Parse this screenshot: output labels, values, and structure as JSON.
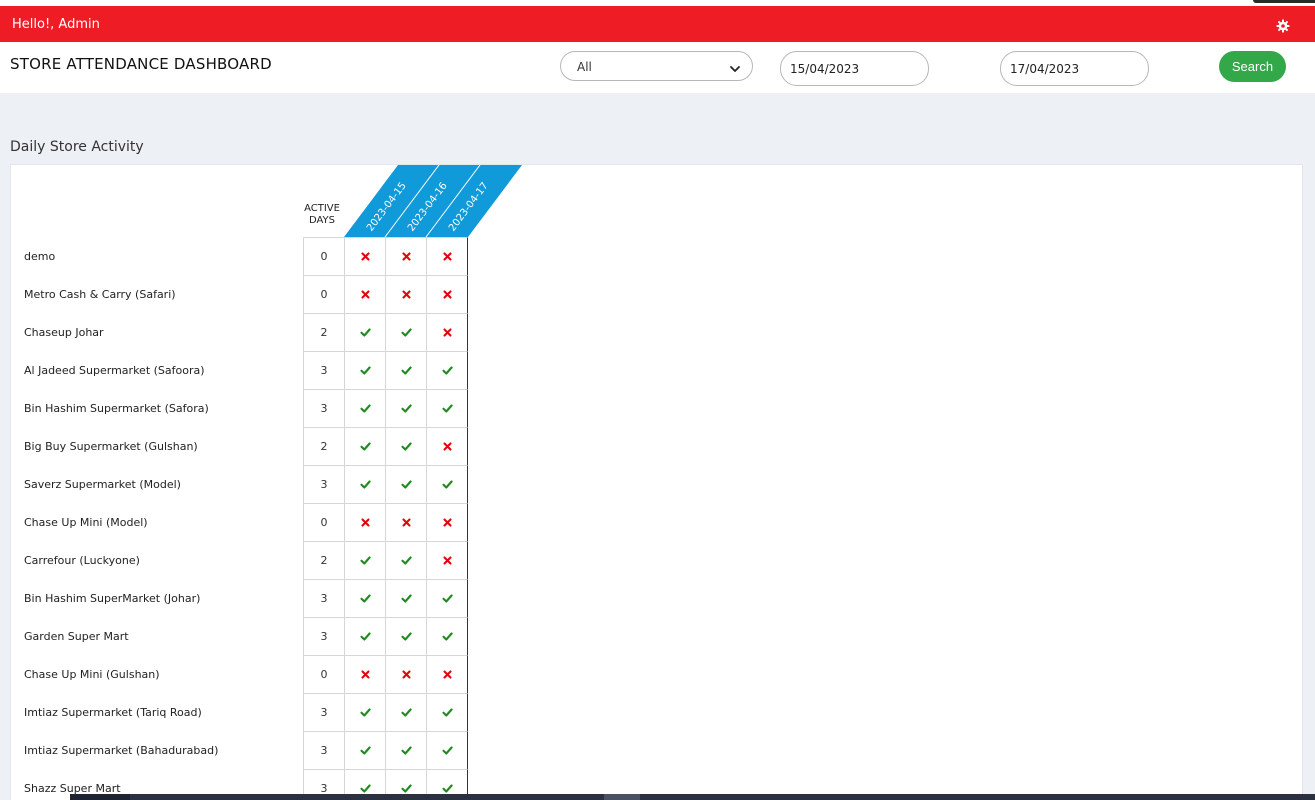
{
  "topbar": {
    "greeting": "Hello!, Admin",
    "settings_icon": "gear-icon",
    "color": "#ee1c25"
  },
  "header": {
    "title": "STORE ATTENDANCE DASHBOARD",
    "filter": {
      "selected": "All"
    },
    "date_from": "15/04/2023",
    "date_to": "17/04/2023",
    "search_label": "Search",
    "search_color": "#32a849"
  },
  "section": {
    "title": "Daily Store Activity"
  },
  "table": {
    "active_days_header": "ACTIVE DAYS",
    "dates": [
      "2023-04-15",
      "2023-04-16",
      "2023-04-17"
    ],
    "header_color": "#119ad9",
    "present_color": "#1f8a1f",
    "absent_color": "#e1060d",
    "rows": [
      {
        "name": "demo",
        "active_days": "0",
        "marks": [
          0,
          0,
          0
        ]
      },
      {
        "name": "Metro Cash & Carry (Safari)",
        "active_days": "0",
        "marks": [
          0,
          0,
          0
        ]
      },
      {
        "name": "Chaseup Johar",
        "active_days": "2",
        "marks": [
          1,
          1,
          0
        ]
      },
      {
        "name": "Al Jadeed Supermarket (Safoora)",
        "active_days": "3",
        "marks": [
          1,
          1,
          1
        ]
      },
      {
        "name": "Bin Hashim Supermarket (Safora)",
        "active_days": "3",
        "marks": [
          1,
          1,
          1
        ]
      },
      {
        "name": "Big Buy Supermarket (Gulshan)",
        "active_days": "2",
        "marks": [
          1,
          1,
          0
        ]
      },
      {
        "name": "Saverz Supermarket (Model)",
        "active_days": "3",
        "marks": [
          1,
          1,
          1
        ]
      },
      {
        "name": "Chase Up Mini (Model)",
        "active_days": "0",
        "marks": [
          0,
          0,
          0
        ]
      },
      {
        "name": "Carrefour (Luckyone)",
        "active_days": "2",
        "marks": [
          1,
          1,
          0
        ]
      },
      {
        "name": "Bin Hashim SuperMarket (Johar)",
        "active_days": "3",
        "marks": [
          1,
          1,
          1
        ]
      },
      {
        "name": "Garden Super Mart",
        "active_days": "3",
        "marks": [
          1,
          1,
          1
        ]
      },
      {
        "name": "Chase Up Mini (Gulshan)",
        "active_days": "0",
        "marks": [
          0,
          0,
          0
        ]
      },
      {
        "name": "Imtiaz Supermarket (Tariq Road)",
        "active_days": "3",
        "marks": [
          1,
          1,
          1
        ]
      },
      {
        "name": "Imtiaz Supermarket (Bahadurabad)",
        "active_days": "3",
        "marks": [
          1,
          1,
          1
        ]
      },
      {
        "name": "Shazz Super Mart",
        "active_days": "3",
        "marks": [
          1,
          1,
          1
        ]
      }
    ]
  }
}
